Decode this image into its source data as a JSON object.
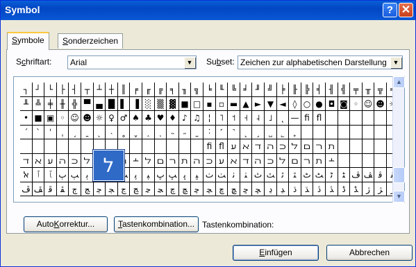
{
  "window": {
    "title": "Symbol"
  },
  "tabs": [
    {
      "label": "Symbole",
      "accel": "S",
      "active": true
    },
    {
      "label": "Sonderzeichen",
      "accel": "S",
      "active": false
    }
  ],
  "font": {
    "label": "Schriftart:",
    "accel": "c",
    "value": "Arial"
  },
  "subset": {
    "label": "Subset:",
    "accel": "b",
    "value": "Zeichen zur alphabetischen Darstellung"
  },
  "grid": {
    "rows": [
      [
        "┐",
        "┘",
        "└",
        "├",
        "┤",
        "┬",
        "┴",
        "┼",
        "║",
        "╒",
        "╓",
        "╔",
        "╕",
        "╖",
        "╗",
        "╘",
        "╙",
        "╚",
        "╛",
        "╜",
        "╝",
        "╞",
        "╟",
        "╠",
        "╡",
        "╢",
        "╣",
        "╤",
        "╥",
        "╦",
        "╧"
      ],
      [
        "╨",
        "╩",
        "╪",
        "╫",
        "╬",
        "▀",
        "▄",
        "█",
        "▌",
        "▐",
        "░",
        "▒",
        "▓",
        "■",
        "□",
        "▪",
        "▫",
        "▬",
        "▲",
        "►",
        "▼",
        "◄",
        "◊",
        "○",
        "●",
        "◘",
        "◙",
        "◦",
        "☺",
        "☻",
        "☼"
      ],
      [
        "•",
        "■",
        "▣",
        "◦",
        "☺",
        "☻",
        "☼",
        "♀",
        "♂",
        "♠",
        "♣",
        "♥",
        "♦",
        "♪",
        "♫",
        "¦",
        "˥",
        "˦",
        "˧",
        "˨",
        "˩",
        "˛",
        "—",
        "ﬁ",
        "ﬂ",
        "",
        "",
        "",
        "",
        "",
        ""
      ],
      [
        "´",
        "ˋ",
        "ˈ",
        "ˌ",
        "ˏ",
        "ˍ",
        "ˎ",
        "˴",
        "˳",
        "ˬ",
        "˰",
        "˲",
        "˵",
        "˶",
        "˷",
        "˸",
        "˹",
        "˺",
        "˻",
        "˼",
        "˽",
        "˾",
        "˿",
        "",
        "",
        "",
        "",
        "",
        "",
        "",
        ""
      ],
      [
        "",
        "",
        "",
        "",
        "",
        "",
        "",
        "",
        "",
        "",
        "",
        "",
        "",
        "",
        "",
        "ﬁ",
        "ﬂ",
        "ﬠ",
        "ﬡ",
        "ﬢ",
        "ﬣ",
        "ﬤ",
        "ﬥ",
        "ﬦ",
        "ﬧ",
        "ﬨ",
        "",
        "",
        "",
        "",
        ""
      ],
      [
        "ﬢ",
        "ﬡ",
        "ﬠ",
        "ﬣ",
        "ﬤ",
        "ﬥ",
        "ﬦ",
        "ﬧ",
        "ﬨ",
        "﬩",
        "ﬥ",
        "ﬦ",
        "ﬧ",
        "ﬨ",
        "ﬣ",
        "ﬤ",
        "ﬠ",
        "ﬡ",
        "ﬢ",
        "ﬣ",
        "ﬤ",
        "ﬥ",
        "ﬦ",
        "ﬧ",
        "ﬨ",
        "﬩",
        "",
        "",
        "",
        "",
        ""
      ],
      [
        "ﭏ",
        "ﭐ",
        "ﭑ",
        "ﭒ",
        "ﭓ",
        "ﭔ",
        "ﭕ",
        "ﭖ",
        "ﭗ",
        "ﭘ",
        "ﭙ",
        "ﭚ",
        "ﭛ",
        "ﭜ",
        "ﭝ",
        "ﭞ",
        "ﭟ",
        "ﭠ",
        "ﭡ",
        "ﭢ",
        "ﭣ",
        "ﭤ",
        "ﭥ",
        "ﭦ",
        "ﭧ",
        "ﭨ",
        "ﭩ",
        "ﭪ",
        "ﭫ",
        "ﭬ",
        "ﭭ"
      ],
      [
        "ﭮ",
        "ﭯ",
        "ﭰ",
        "ﭱ",
        "ﭲ",
        "ﭳ",
        "ﭴ",
        "ﭵ",
        "ﭶ",
        "ﭷ",
        "ﭸ",
        "ﭹ",
        "ﭺ",
        "ﭻ",
        "ﭼ",
        "ﭽ",
        "ﭾ",
        "ﭿ",
        "ﮀ",
        "ﮁ",
        "ﮂ",
        "ﮃ",
        "ﮄ",
        "ﮅ",
        "ﮆ",
        "ﮇ",
        "ﮈ",
        "ﮉ",
        "ﮊ",
        "ﮋ",
        "ﮌ"
      ]
    ],
    "selected_glyph": "ל"
  },
  "buttons": {
    "autocorrect": {
      "label": "AutoKorrektur...",
      "accel_index": 4
    },
    "shortcut": {
      "label": "Tastenkombination...",
      "accel_index": 0
    },
    "insert": {
      "label": "Einfügen",
      "accel_index": 0
    },
    "cancel": {
      "label": "Abbrechen"
    }
  },
  "shortcut_label": "Tastenkombination:",
  "titlebar_icons": {
    "help": "?",
    "close": "✕"
  }
}
